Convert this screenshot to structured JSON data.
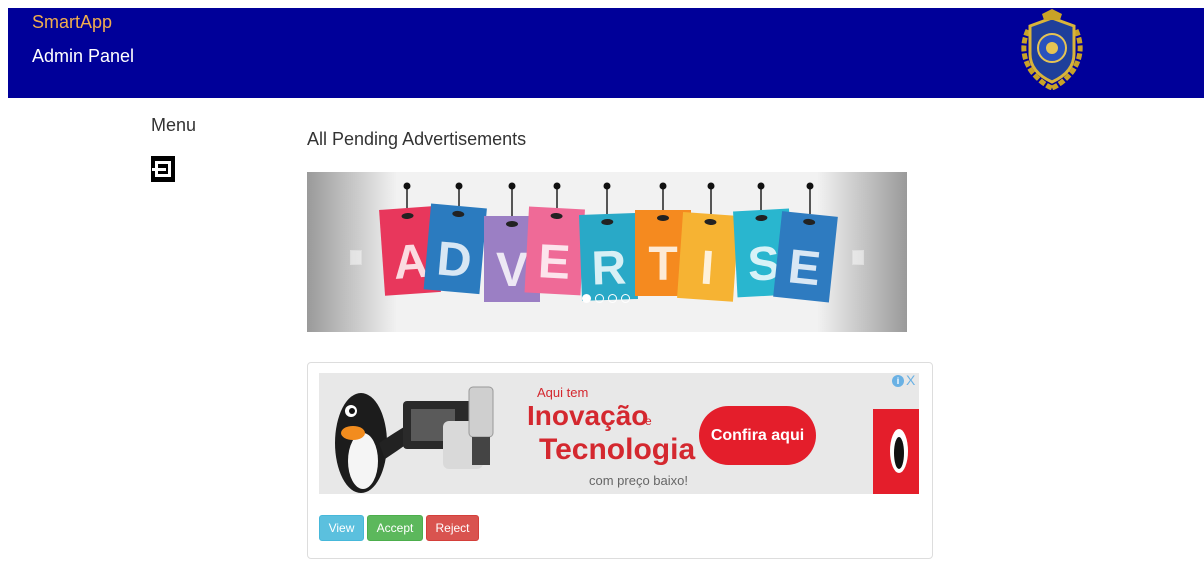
{
  "header": {
    "brand": "SmartApp",
    "subtitle": "Admin Panel",
    "brand_color": "#f0ad4e",
    "background_color": "#000099",
    "logo_icon": "crest-emblem-icon"
  },
  "sidebar": {
    "menu_label": "Menu",
    "toggle_icon": "menu-toggle-icon"
  },
  "main": {
    "title": "All Pending Advertisements",
    "carousel": {
      "letters": [
        "A",
        "D",
        "V",
        "E",
        "R",
        "T",
        "I",
        "S",
        "E"
      ],
      "letter_colors": [
        "#e8375c",
        "#2b7bbf",
        "#9b7fc4",
        "#ef6a97",
        "#29a9c7",
        "#f58a1f",
        "#f6b333",
        "#29b6cf",
        "#2e7bc0"
      ],
      "slide_count": 4,
      "active_slide": 1
    },
    "ad_card": {
      "banner": {
        "line1": "Aqui tem",
        "line2": "Inovação",
        "line2_suffix": "e",
        "line3": "Tecnologia",
        "line4": "com preço baixo!",
        "cta_label": "Confira aqui",
        "info_label": "i",
        "close_label": "X",
        "accent_color": "#e41e2b"
      },
      "buttons": {
        "view": "View",
        "accept": "Accept",
        "reject": "Reject"
      }
    }
  }
}
